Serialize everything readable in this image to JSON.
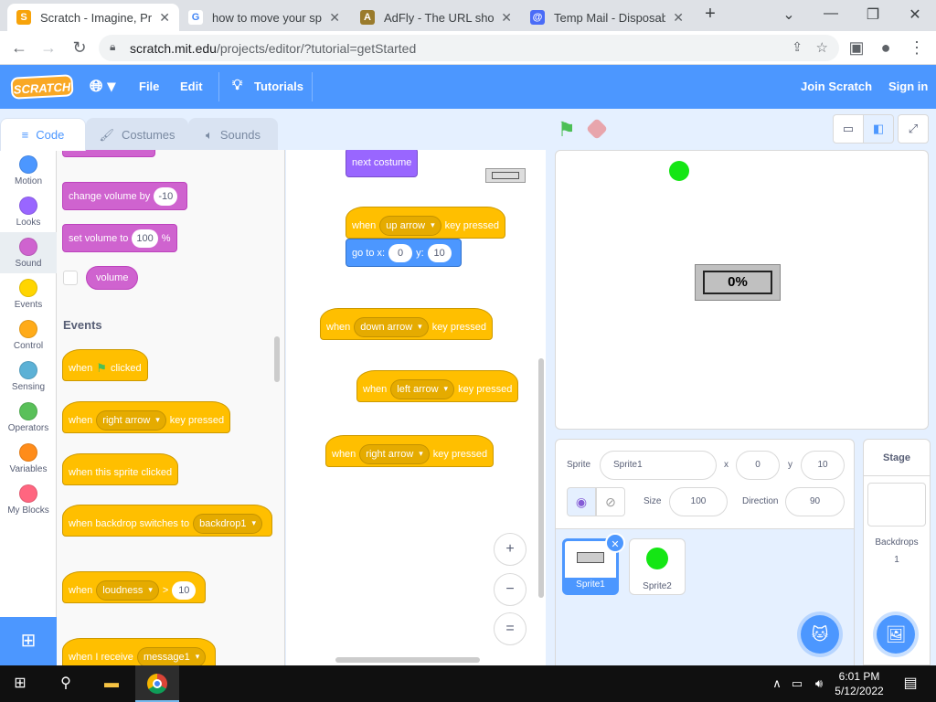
{
  "browser": {
    "tabs": [
      {
        "title": "Scratch - Imagine, Prog",
        "favicon": "scratch-icon",
        "active": true
      },
      {
        "title": "how to move your sprit",
        "favicon": "google-icon"
      },
      {
        "title": "AdFly - The URL shorte",
        "favicon": "adfly-icon"
      },
      {
        "title": "Temp Mail - Disposable",
        "favicon": "tempmail-icon"
      }
    ],
    "new_tab": "+",
    "url_host": "scratch.mit.edu",
    "url_path": "/projects/editor/?tutorial=getStarted"
  },
  "menubar": {
    "logo": "SCRATCH",
    "file": "File",
    "edit": "Edit",
    "tutorials": "Tutorials",
    "join": "Join Scratch",
    "signin": "Sign in"
  },
  "editor_tabs": {
    "code": "Code",
    "costumes": "Costumes",
    "sounds": "Sounds"
  },
  "categories": [
    {
      "label": "Motion",
      "color": "#4c97ff"
    },
    {
      "label": "Looks",
      "color": "#9966ff"
    },
    {
      "label": "Sound",
      "color": "#cf63cf"
    },
    {
      "label": "Events",
      "color": "#ffd500"
    },
    {
      "label": "Control",
      "color": "#ffab19"
    },
    {
      "label": "Sensing",
      "color": "#5cb1d6"
    },
    {
      "label": "Operators",
      "color": "#59c059"
    },
    {
      "label": "Variables",
      "color": "#ff8c1a"
    },
    {
      "label": "My Blocks",
      "color": "#ff6680"
    }
  ],
  "palette": {
    "change_volume": "change volume by",
    "change_volume_val": "-10",
    "set_volume": "set volume to",
    "set_volume_val": "100",
    "percent": "%",
    "volume": "volume",
    "events_title": "Events",
    "when": "when",
    "clicked": "clicked",
    "right_arrow": "right arrow",
    "key_pressed": "key pressed",
    "sprite_clicked": "when this sprite clicked",
    "backdrop_switches": "when backdrop switches to",
    "backdrop1": "backdrop1",
    "loudness": "loudness",
    "gt": ">",
    "loud_val": "10",
    "i_receive": "when I receive",
    "message1": "message1"
  },
  "workspace": {
    "next_costume": "next costume",
    "when": "when",
    "key_pressed": "key pressed",
    "up_arrow": "up arrow",
    "goto": "go to x:",
    "goto_x": "0",
    "y_label": "y:",
    "goto_y": "10",
    "down_arrow": "down arrow",
    "left_arrow": "left arrow",
    "right_arrow": "right arrow",
    "zoom_in": "+",
    "zoom_out": "−",
    "zoom_reset": "="
  },
  "stage": {
    "meter_text": "0%"
  },
  "sprite_info": {
    "sprite_label": "Sprite",
    "sprite_name": "Sprite1",
    "x_label": "x",
    "x": "0",
    "y_label": "y",
    "y": "10",
    "size_label": "Size",
    "size": "100",
    "direction_label": "Direction",
    "direction": "90"
  },
  "sprites": [
    {
      "name": "Sprite1",
      "selected": true
    },
    {
      "name": "Sprite2"
    }
  ],
  "stage_pane": {
    "title": "Stage",
    "backdrops_label": "Backdrops",
    "backdrops_count": "1"
  },
  "taskbar": {
    "time": "6:01 PM",
    "date": "5/12/2022"
  }
}
